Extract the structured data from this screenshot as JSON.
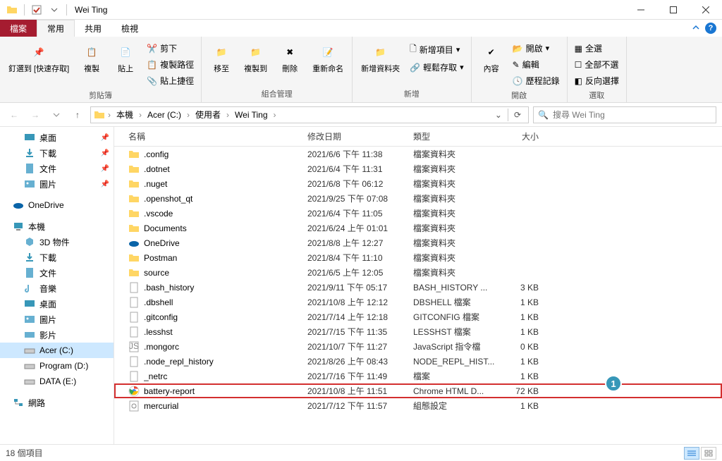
{
  "title": "Wei Ting",
  "tabs": {
    "file": "檔案",
    "home": "常用",
    "share": "共用",
    "view": "檢視"
  },
  "ribbon": {
    "clipboard": {
      "pin": "釘選到 [快速存取]",
      "copy": "複製",
      "paste": "貼上",
      "cut": "剪下",
      "copypath": "複製路徑",
      "shortcut": "貼上捷徑",
      "label": "剪貼簿"
    },
    "organize": {
      "moveto": "移至",
      "copyto": "複製到",
      "delete": "刪除",
      "rename": "重新命名",
      "label": "組合管理"
    },
    "new": {
      "newfolder": "新增資料夾",
      "newitem": "新增項目",
      "easyaccess": "輕鬆存取",
      "label": "新增"
    },
    "open": {
      "properties": "內容",
      "open": "開啟",
      "edit": "編輯",
      "history": "歷程記錄",
      "label": "開啟"
    },
    "select": {
      "selectall": "全選",
      "selectnone": "全部不選",
      "invert": "反向選擇",
      "label": "選取"
    }
  },
  "breadcrumb": [
    "本機",
    "Acer (C:)",
    "使用者",
    "Wei Ting"
  ],
  "search_placeholder": "搜尋 Wei Ting",
  "sidebar": {
    "quick": [
      {
        "label": "桌面",
        "icon": "desktop",
        "pin": true
      },
      {
        "label": "下載",
        "icon": "download",
        "pin": true
      },
      {
        "label": "文件",
        "icon": "document",
        "pin": true
      },
      {
        "label": "圖片",
        "icon": "picture",
        "pin": true
      }
    ],
    "onedrive": "OneDrive",
    "thispc": "本機",
    "pcitems": [
      {
        "label": "3D 物件",
        "icon": "3d"
      },
      {
        "label": "下載",
        "icon": "download"
      },
      {
        "label": "文件",
        "icon": "document"
      },
      {
        "label": "音樂",
        "icon": "music"
      },
      {
        "label": "桌面",
        "icon": "desktop"
      },
      {
        "label": "圖片",
        "icon": "picture"
      },
      {
        "label": "影片",
        "icon": "video"
      },
      {
        "label": "Acer (C:)",
        "icon": "drive",
        "selected": true
      },
      {
        "label": "Program (D:)",
        "icon": "drive"
      },
      {
        "label": "DATA (E:)",
        "icon": "drive"
      }
    ],
    "network": "網路"
  },
  "columns": {
    "name": "名稱",
    "date": "修改日期",
    "type": "類型",
    "size": "大小"
  },
  "files": [
    {
      "name": ".config",
      "date": "2021/6/6 下午 11:38",
      "type": "檔案資料夾",
      "size": "",
      "icon": "folder"
    },
    {
      "name": ".dotnet",
      "date": "2021/6/4 下午 11:31",
      "type": "檔案資料夾",
      "size": "",
      "icon": "folder"
    },
    {
      "name": ".nuget",
      "date": "2021/6/8 下午 06:12",
      "type": "檔案資料夾",
      "size": "",
      "icon": "folder"
    },
    {
      "name": ".openshot_qt",
      "date": "2021/9/25 下午 07:08",
      "type": "檔案資料夾",
      "size": "",
      "icon": "folder"
    },
    {
      "name": ".vscode",
      "date": "2021/6/4 下午 11:05",
      "type": "檔案資料夾",
      "size": "",
      "icon": "folder"
    },
    {
      "name": "Documents",
      "date": "2021/6/24 上午 01:01",
      "type": "檔案資料夾",
      "size": "",
      "icon": "folder"
    },
    {
      "name": "OneDrive",
      "date": "2021/8/8 上午 12:27",
      "type": "檔案資料夾",
      "size": "",
      "icon": "onedrive"
    },
    {
      "name": "Postman",
      "date": "2021/8/4 下午 11:10",
      "type": "檔案資料夾",
      "size": "",
      "icon": "folder"
    },
    {
      "name": "source",
      "date": "2021/6/5 上午 12:05",
      "type": "檔案資料夾",
      "size": "",
      "icon": "folder"
    },
    {
      "name": ".bash_history",
      "date": "2021/9/11 下午 05:17",
      "type": "BASH_HISTORY ...",
      "size": "3 KB",
      "icon": "file"
    },
    {
      "name": ".dbshell",
      "date": "2021/10/8 上午 12:12",
      "type": "DBSHELL 檔案",
      "size": "1 KB",
      "icon": "file"
    },
    {
      "name": ".gitconfig",
      "date": "2021/7/14 上午 12:18",
      "type": "GITCONFIG 檔案",
      "size": "1 KB",
      "icon": "file"
    },
    {
      "name": ".lesshst",
      "date": "2021/7/15 下午 11:35",
      "type": "LESSHST 檔案",
      "size": "1 KB",
      "icon": "file"
    },
    {
      "name": ".mongorc",
      "date": "2021/10/7 下午 11:27",
      "type": "JavaScript 指令檔",
      "size": "0 KB",
      "icon": "js"
    },
    {
      "name": ".node_repl_history",
      "date": "2021/8/26 上午 08:43",
      "type": "NODE_REPL_HIST...",
      "size": "1 KB",
      "icon": "file"
    },
    {
      "name": "_netrc",
      "date": "2021/7/16 下午 11:49",
      "type": "檔案",
      "size": "1 KB",
      "icon": "file"
    },
    {
      "name": "battery-report",
      "date": "2021/10/8 上午 11:51",
      "type": "Chrome HTML D...",
      "size": "72 KB",
      "icon": "chrome",
      "highlight": true
    },
    {
      "name": "mercurial",
      "date": "2021/7/12 下午 11:57",
      "type": "組態設定",
      "size": "1 KB",
      "icon": "config"
    }
  ],
  "status": "18 個項目"
}
